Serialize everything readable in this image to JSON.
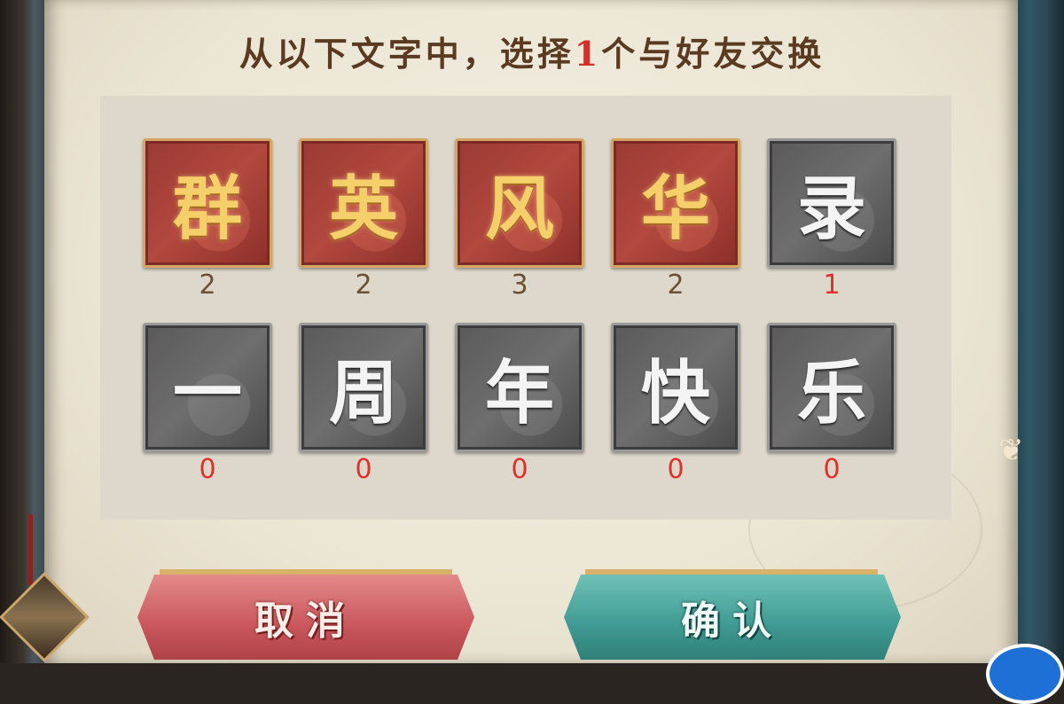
{
  "title": {
    "prefix": "从以下文字中，选择",
    "number": "1",
    "suffix": "个与好友交换"
  },
  "tiles": [
    {
      "char": "群",
      "count": "2",
      "style": "red"
    },
    {
      "char": "英",
      "count": "2",
      "style": "red"
    },
    {
      "char": "风",
      "count": "3",
      "style": "red"
    },
    {
      "char": "华",
      "count": "2",
      "style": "red"
    },
    {
      "char": "录",
      "count": "1",
      "style": "gray"
    },
    {
      "char": "一",
      "count": "0",
      "style": "gray"
    },
    {
      "char": "周",
      "count": "0",
      "style": "gray"
    },
    {
      "char": "年",
      "count": "0",
      "style": "gray"
    },
    {
      "char": "快",
      "count": "0",
      "style": "gray"
    },
    {
      "char": "乐",
      "count": "0",
      "style": "gray"
    }
  ],
  "buttons": {
    "cancel": "取消",
    "confirm": "确认"
  },
  "colors": {
    "title": "#5a3b22",
    "highlight": "#d0322a",
    "tile_red": "#b2483e",
    "tile_gray": "#6e6e6e",
    "cancel_button": "#c9575c",
    "confirm_button": "#3f9a93"
  }
}
